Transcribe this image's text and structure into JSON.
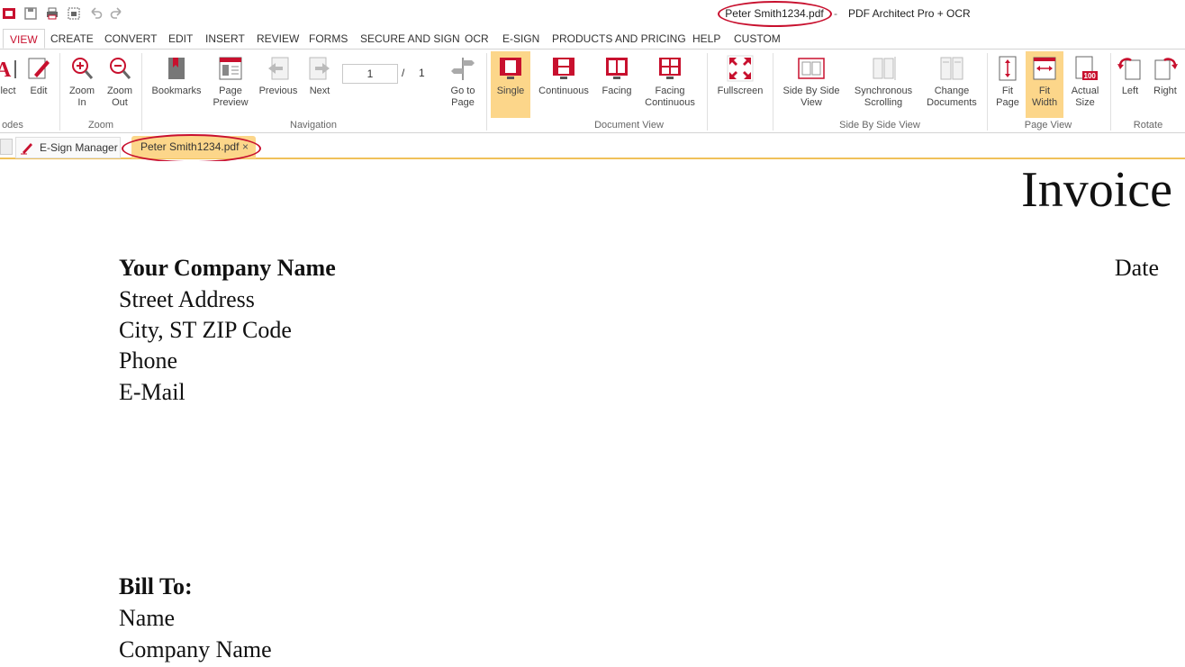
{
  "window": {
    "filename": "Peter Smith1234.pdf",
    "separator": "-",
    "app_name": "PDF Architect Pro + OCR"
  },
  "menu": {
    "tabs": [
      "VIEW",
      "CREATE",
      "CONVERT",
      "EDIT",
      "INSERT",
      "REVIEW",
      "FORMS",
      "SECURE AND SIGN",
      "OCR",
      "E-SIGN",
      "PRODUCTS AND PRICING",
      "HELP",
      "CUSTOM"
    ],
    "active": "VIEW"
  },
  "ribbon": {
    "modes": {
      "select_label": "elect",
      "edit_label": "Edit",
      "group": "odes"
    },
    "zoom": {
      "zoom_in": "Zoom In",
      "zoom_out": "Zoom Out",
      "group": "Zoom"
    },
    "navigation": {
      "bookmarks": "Bookmarks",
      "page_preview": "Page Preview",
      "previous": "Previous",
      "next": "Next",
      "current_page": "1",
      "slash": "/",
      "total_pages": "1",
      "go_to_page": "Go to Page",
      "group": "Navigation"
    },
    "document_view": {
      "single": "Single",
      "continuous": "Continuous",
      "facing": "Facing",
      "facing_continuous": "Facing Continuous",
      "fullscreen": "Fullscreen",
      "group": "Document View",
      "active": "Single"
    },
    "side_by_side": {
      "side_by_side_view": "Side By Side View",
      "synchronous_scrolling": "Synchronous Scrolling",
      "change_documents": "Change Documents",
      "group": "Side By Side View"
    },
    "page_view": {
      "fit_page": "Fit Page",
      "fit_width": "Fit Width",
      "actual_size": "Actual Size",
      "actual_size_badge": "100",
      "group": "Page View",
      "active": "Fit Width"
    },
    "rotate": {
      "left": "Left",
      "right": "Right",
      "group": "Rotate"
    }
  },
  "doc_tabs": {
    "esign_manager": "E-Sign Manager",
    "file": "Peter Smith1234.pdf",
    "close": "×"
  },
  "document": {
    "title": "Invoice",
    "date_label": "Date",
    "company_name": "Your Company Name",
    "street": "Street Address",
    "city": "City, ST ZIP Code",
    "phone": "Phone",
    "email": "E-Mail",
    "bill_to": "Bill To:",
    "bill_name": "Name",
    "bill_company": "Company Name"
  },
  "colors": {
    "accent_red": "#c8102e",
    "active_highlight": "#fcd68a",
    "tab_underline": "#f0c15a"
  }
}
